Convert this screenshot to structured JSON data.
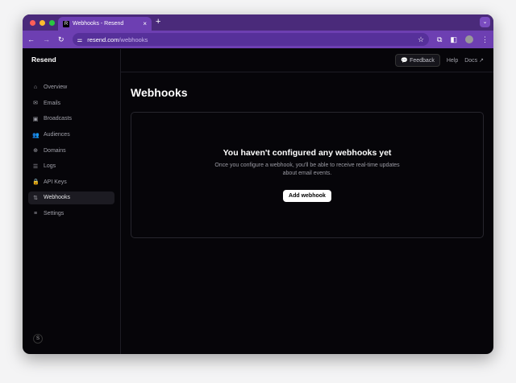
{
  "browser": {
    "tab_title": "Webhooks - Resend",
    "favicon": "R",
    "url_host": "resend.com",
    "url_path": "/webhooks"
  },
  "sidebar": {
    "brand": "Resend",
    "user_initial": "S",
    "items": [
      {
        "label": "Overview",
        "icon": "⌂"
      },
      {
        "label": "Emails",
        "icon": "✉"
      },
      {
        "label": "Broadcasts",
        "icon": "▣"
      },
      {
        "label": "Audiences",
        "icon": "👥"
      },
      {
        "label": "Domains",
        "icon": "⊕"
      },
      {
        "label": "Logs",
        "icon": "☰"
      },
      {
        "label": "API Keys",
        "icon": "🔒"
      },
      {
        "label": "Webhooks",
        "icon": "⇅"
      },
      {
        "label": "Settings",
        "icon": "≡"
      }
    ]
  },
  "header": {
    "feedback": "Feedback",
    "help": "Help",
    "docs": "Docs ↗"
  },
  "page": {
    "title": "Webhooks"
  },
  "empty": {
    "title": "You haven't configured any webhooks yet",
    "text": "Once you configure a webhook, you'll be able to receive real-time updates about email events.",
    "button": "Add webhook"
  }
}
